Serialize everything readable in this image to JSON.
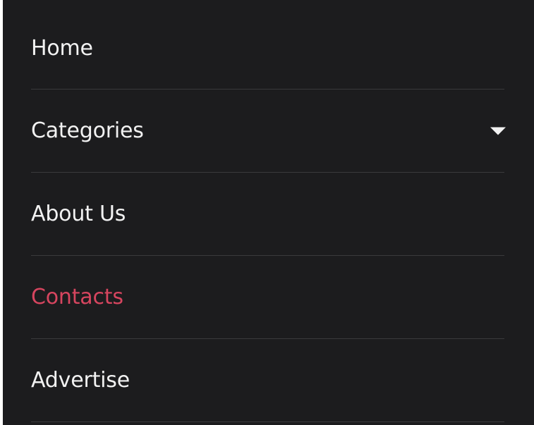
{
  "menu": {
    "accent_color": "#d6455f",
    "background_color": "#1c1c1e",
    "items": [
      {
        "label": "Home",
        "active": false,
        "has_dropdown": false
      },
      {
        "label": "Categories",
        "active": false,
        "has_dropdown": true
      },
      {
        "label": "About Us",
        "active": false,
        "has_dropdown": false
      },
      {
        "label": "Contacts",
        "active": true,
        "has_dropdown": false
      },
      {
        "label": "Advertise",
        "active": false,
        "has_dropdown": false
      }
    ],
    "dropdown_icon": "caret-down-icon"
  }
}
